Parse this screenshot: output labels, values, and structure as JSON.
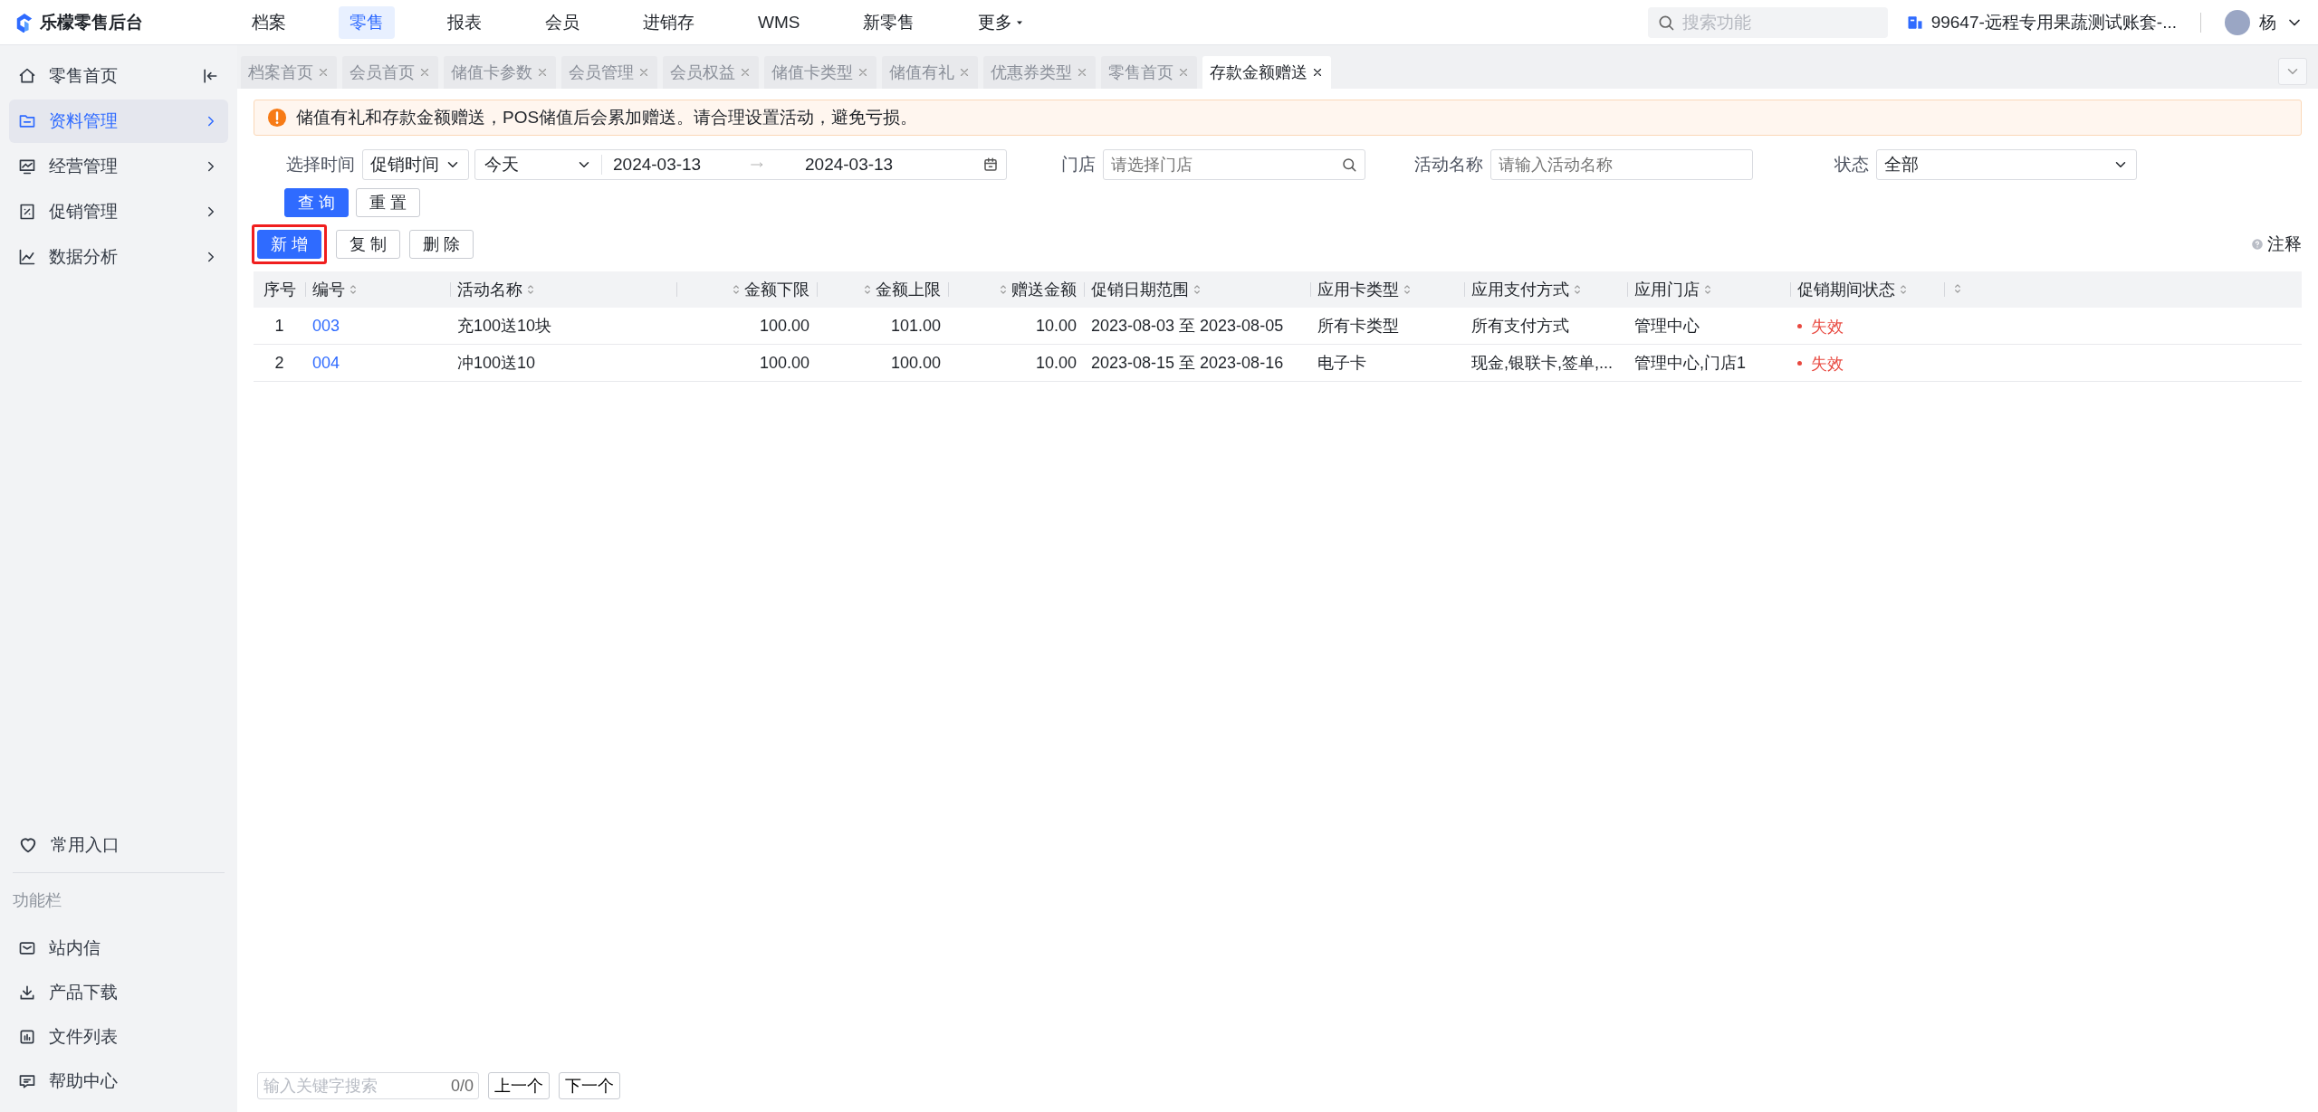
{
  "brand": {
    "name": "乐檬零售后台"
  },
  "top_nav": [
    {
      "label": "档案",
      "selected": false,
      "kind": "link"
    },
    {
      "label": "零售",
      "selected": true,
      "kind": "link"
    },
    {
      "label": "报表",
      "selected": false,
      "kind": "link"
    },
    {
      "label": "会员",
      "selected": false,
      "kind": "link"
    },
    {
      "label": "进销存",
      "selected": false,
      "kind": "link"
    },
    {
      "label": "WMS",
      "selected": false,
      "kind": "link"
    },
    {
      "label": "新零售",
      "selected": false,
      "kind": "link"
    },
    {
      "label": "更多",
      "selected": false,
      "kind": "menu"
    }
  ],
  "search": {
    "placeholder": "搜索功能"
  },
  "account": {
    "label": "99647-远程专用果蔬测试账套-..."
  },
  "user": {
    "name": "杨"
  },
  "sidebar": {
    "items": [
      {
        "label": "零售首页",
        "kind": "home",
        "selected": false
      },
      {
        "label": "资料管理",
        "kind": "group",
        "selected": true
      },
      {
        "label": "经营管理",
        "kind": "group",
        "selected": false
      },
      {
        "label": "促销管理",
        "kind": "group",
        "selected": false
      },
      {
        "label": "数据分析",
        "kind": "group",
        "selected": false
      }
    ],
    "favorites": {
      "label": "常用入口"
    },
    "section_title": "功能栏",
    "tools": [
      {
        "label": "站内信"
      },
      {
        "label": "产品下载"
      },
      {
        "label": "文件列表"
      },
      {
        "label": "帮助中心"
      }
    ]
  },
  "tabs": [
    {
      "label": "档案首页",
      "selected": false
    },
    {
      "label": "会员首页",
      "selected": false
    },
    {
      "label": "储值卡参数",
      "selected": false
    },
    {
      "label": "会员管理",
      "selected": false
    },
    {
      "label": "会员权益",
      "selected": false
    },
    {
      "label": "储值卡类型",
      "selected": false
    },
    {
      "label": "储值有礼",
      "selected": false
    },
    {
      "label": "优惠券类型",
      "selected": false
    },
    {
      "label": "零售首页",
      "selected": false
    },
    {
      "label": "存款金额赠送",
      "selected": true
    }
  ],
  "notice": {
    "text": "储值有礼和存款金额赠送，POS储值后会累加赠送。请合理设置活动，避免亏损。"
  },
  "filters": {
    "time": {
      "label": "选择时间",
      "type_value": "促销时间",
      "range_value": "今天",
      "start": "2024-03-13",
      "end": "2024-03-13"
    },
    "store": {
      "label": "门店",
      "placeholder": "请选择门店"
    },
    "name": {
      "label": "活动名称",
      "placeholder": "请输入活动名称"
    },
    "status": {
      "label": "状态",
      "value": "全部"
    }
  },
  "query_buttons": [
    {
      "label": "查 询",
      "kind": "primary"
    },
    {
      "label": "重 置",
      "kind": "default"
    }
  ],
  "actions": [
    {
      "label": "新 增",
      "kind": "primary",
      "highlighted": true
    },
    {
      "label": "复 制",
      "kind": "default",
      "highlighted": false
    },
    {
      "label": "删 除",
      "kind": "default",
      "highlighted": false
    }
  ],
  "help": {
    "label": "注释"
  },
  "table": {
    "columns": [
      {
        "label": "序号",
        "sortable": false
      },
      {
        "label": "编号",
        "sortable": true
      },
      {
        "label": "活动名称",
        "sortable": true
      },
      {
        "label": "金额下限",
        "sortable": true
      },
      {
        "label": "金额上限",
        "sortable": true
      },
      {
        "label": "赠送金额",
        "sortable": true
      },
      {
        "label": "促销日期范围",
        "sortable": true
      },
      {
        "label": "应用卡类型",
        "sortable": true
      },
      {
        "label": "应用支付方式",
        "sortable": true
      },
      {
        "label": "应用门店",
        "sortable": true
      },
      {
        "label": "促销期间状态",
        "sortable": true
      },
      {
        "sortable": true
      }
    ],
    "rows": [
      {
        "index": "1",
        "code": "003",
        "name": "充100送10块",
        "min_amount": "100.00",
        "max_amount": "101.00",
        "gift_amount": "10.00",
        "date_range": "2023-08-03 至 2023-08-05",
        "card_type": "所有卡类型",
        "payment": "所有支付方式",
        "stores": "管理中心",
        "status": {
          "label": "失效",
          "color": "#e8483f"
        }
      },
      {
        "index": "2",
        "code": "004",
        "name": "冲100送10",
        "min_amount": "100.00",
        "max_amount": "100.00",
        "gift_amount": "10.00",
        "date_range": "2023-08-15 至 2023-08-16",
        "card_type": "电子卡",
        "payment": "现金,银联卡,签单,...",
        "stores": "管理中心,门店1",
        "status": {
          "label": "失效",
          "color": "#e8483f"
        }
      }
    ]
  },
  "find_bar": {
    "placeholder": "输入关键字搜索",
    "count": "0/0",
    "prev": "上一个",
    "next": "下一个"
  }
}
